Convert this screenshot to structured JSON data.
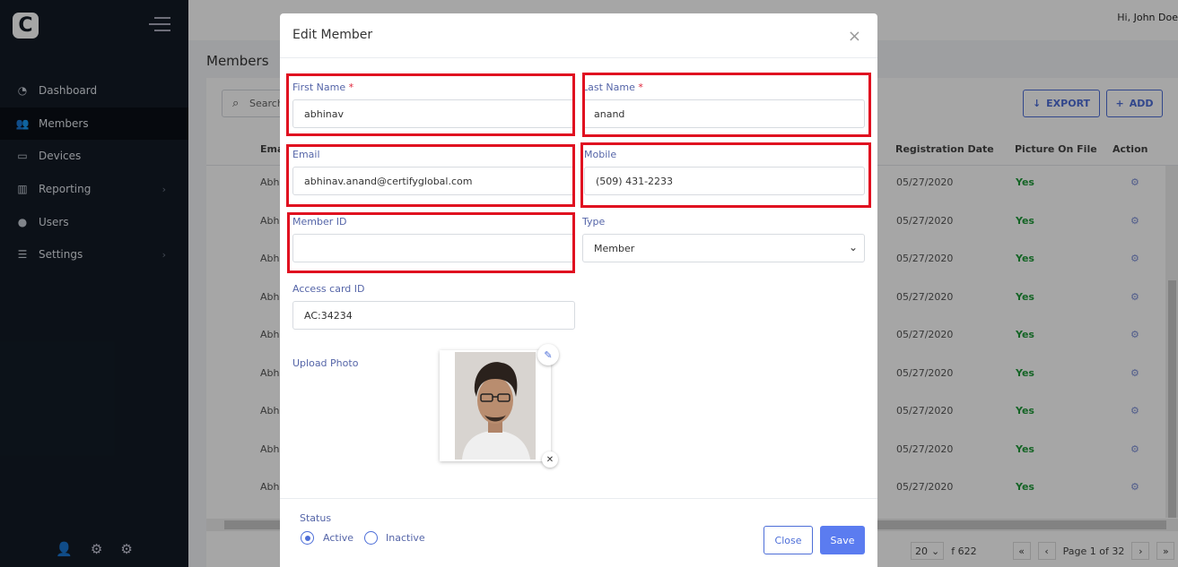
{
  "sidebar": {
    "logo_letter": "C",
    "items": [
      {
        "label": "Dashboard",
        "icon": "dashboard-icon"
      },
      {
        "label": "Members",
        "icon": "users-icon"
      },
      {
        "label": "Devices",
        "icon": "tablet-icon"
      },
      {
        "label": "Reporting",
        "icon": "chart-icon"
      },
      {
        "label": "Users",
        "icon": "user-icon"
      },
      {
        "label": "Settings",
        "icon": "sliders-icon"
      }
    ],
    "active_item": "Members"
  },
  "header": {
    "greeting": "Hi,",
    "user_name": "John Doe"
  },
  "page": {
    "title": "Members"
  },
  "toolbar": {
    "search_placeholder": "Search",
    "export_label": "EXPORT",
    "add_label": "ADD"
  },
  "table": {
    "headers": {
      "email": "Email",
      "registration_date": "Registration Date",
      "picture_on_file": "Picture On File",
      "action": "Action"
    },
    "rows": [
      {
        "email": "Abh",
        "date": "05/27/2020",
        "picture": "Yes"
      },
      {
        "email": "Abh",
        "date": "05/27/2020",
        "picture": "Yes"
      },
      {
        "email": "Abh",
        "date": "05/27/2020",
        "picture": "Yes"
      },
      {
        "email": "Abh",
        "date": "05/27/2020",
        "picture": "Yes"
      },
      {
        "email": "Abh",
        "date": "05/27/2020",
        "picture": "Yes"
      },
      {
        "email": "Abh",
        "date": "05/27/2020",
        "picture": "Yes"
      },
      {
        "email": "Abh",
        "date": "05/27/2020",
        "picture": "Yes"
      },
      {
        "email": "Abh",
        "date": "05/27/2020",
        "picture": "Yes"
      },
      {
        "email": "Abh",
        "date": "05/27/2020",
        "picture": "Yes"
      }
    ]
  },
  "pagination": {
    "page_size": "20",
    "total_text": "f 622",
    "page_text": "Page 1 of 32"
  },
  "modal": {
    "title": "Edit Member",
    "fields": {
      "first_name": {
        "label": "First Name",
        "value": "abhinav"
      },
      "last_name": {
        "label": "Last Name",
        "value": "anand"
      },
      "email": {
        "label": "Email",
        "value": "abhinav.anand@certifyglobal.com"
      },
      "mobile": {
        "label": "Mobile",
        "value": "(509) 431-2233"
      },
      "member_id": {
        "label": "Member ID",
        "value": ""
      },
      "type": {
        "label": "Type",
        "value": "Member"
      },
      "access_card": {
        "label": "Access card ID",
        "value": "AC:34234"
      },
      "upload_photo": {
        "label": "Upload Photo"
      }
    },
    "required_mark": "*",
    "status": {
      "label": "Status",
      "options": [
        "Active",
        "Inactive"
      ],
      "selected": "Active"
    },
    "close_label": "Close",
    "save_label": "Save"
  },
  "colors": {
    "accent": "#5b7cf0",
    "highlight": "#e01020",
    "sidebar": "#131b26",
    "success": "#1f9a3a"
  }
}
